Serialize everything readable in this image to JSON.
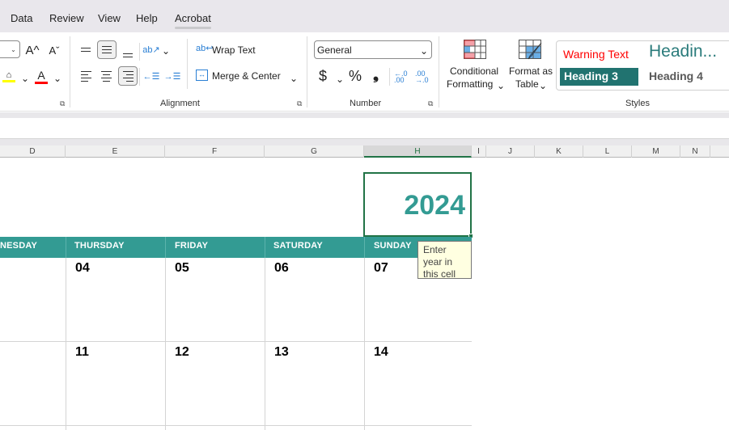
{
  "menu": {
    "tabs": [
      {
        "label": "Data",
        "active": false
      },
      {
        "label": "Review",
        "active": false
      },
      {
        "label": "View",
        "active": false
      },
      {
        "label": "Help",
        "active": false
      },
      {
        "label": "Acrobat",
        "active": true
      }
    ]
  },
  "ribbon": {
    "font": {
      "increase_font_icon": "A^",
      "decrease_font_icon": "Aˇ",
      "fill_color": "#ffff00",
      "font_color": "#ff0000",
      "font_color_glyph": "A"
    },
    "alignment": {
      "label": "Alignment",
      "wrap_text": "Wrap Text",
      "merge_center": "Merge & Center",
      "active_vertical": "middle",
      "active_horizontal": "right"
    },
    "number": {
      "label": "Number",
      "format_value": "General",
      "currency": "$",
      "percent": "%",
      "comma": "❟"
    },
    "styles": {
      "label": "Styles",
      "conditional_formatting": [
        "Conditional",
        "Formatting"
      ],
      "format_as_table": [
        "Format as",
        "Table"
      ],
      "gallery": [
        {
          "label": "Warning Text",
          "color": "#ff0000"
        },
        {
          "label": "Headin...",
          "color": "#2a7b7b"
        },
        {
          "label": "Heading 3",
          "color": "#ffffff",
          "bg": "#217370"
        },
        {
          "label": "Heading 4",
          "color": "#595959"
        }
      ]
    }
  },
  "columns": [
    "D",
    "E",
    "F",
    "G",
    "H",
    "I",
    "J",
    "K",
    "L",
    "M",
    "N"
  ],
  "selected_column": "H",
  "sheet": {
    "year": "2024",
    "accent": "#339b93",
    "day_names": [
      "NESDAY",
      "THURSDAY",
      "FRIDAY",
      "SATURDAY",
      "SUNDAY"
    ],
    "week1": [
      "",
      "04",
      "05",
      "06",
      "07"
    ],
    "week2": [
      "",
      "11",
      "12",
      "13",
      "14"
    ],
    "tooltip": "Enter year in this cell"
  }
}
